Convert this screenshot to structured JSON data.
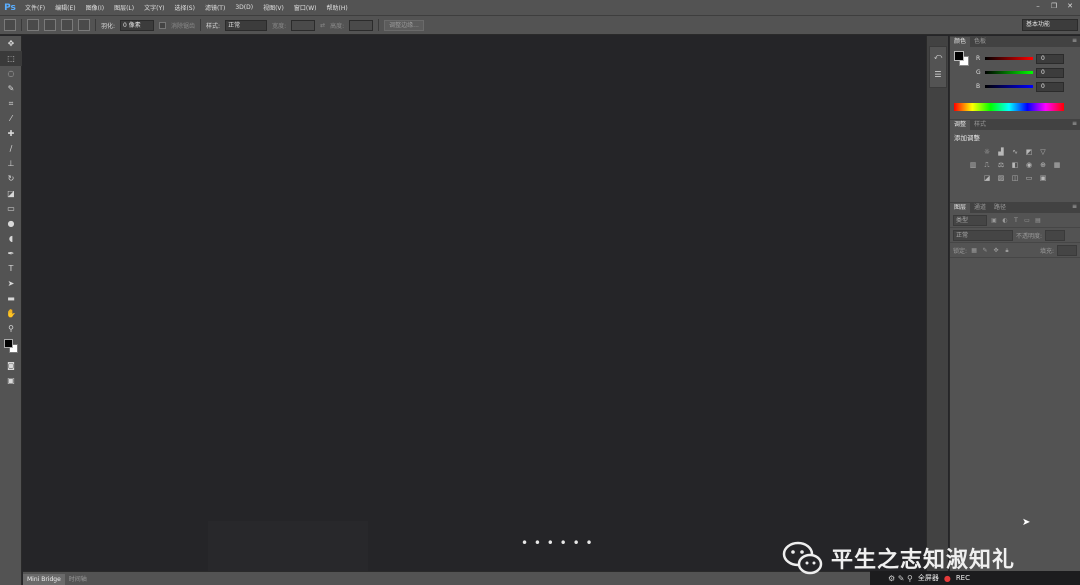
{
  "app": {
    "logo": "Ps"
  },
  "menubar": {
    "items": [
      "文件(F)",
      "编辑(E)",
      "图像(I)",
      "图层(L)",
      "文字(Y)",
      "选择(S)",
      "滤镜(T)",
      "3D(D)",
      "视图(V)",
      "窗口(W)",
      "帮助(H)"
    ]
  },
  "options": {
    "feather_label": "羽化:",
    "feather_value": "0 像素",
    "antialias_label": "消除锯齿",
    "style_label": "样式:",
    "style_value": "正常",
    "width_label": "宽度:",
    "height_label": "高度:",
    "refine_edge_label": "调整边缘...",
    "workspace": "基本功能"
  },
  "status": {
    "tabs": [
      "Mini Bridge",
      "时间轴"
    ]
  },
  "canvas": {
    "loading": "• • • • • •"
  },
  "color_panel": {
    "tabs": [
      "颜色",
      "色板"
    ],
    "sliders": [
      {
        "label": "R",
        "value": "0",
        "track": "linear-gradient(90deg,#000,#f00)"
      },
      {
        "label": "G",
        "value": "0",
        "track": "linear-gradient(90deg,#000,#0f0)"
      },
      {
        "label": "B",
        "value": "0",
        "track": "linear-gradient(90deg,#000,#00f)"
      }
    ]
  },
  "adjustments_panel": {
    "tabs": [
      "调整",
      "样式"
    ],
    "title": "添加调整"
  },
  "layers_panel": {
    "tabs": [
      "图层",
      "通道",
      "路径"
    ],
    "filter_label": "类型",
    "blend_mode": "正常",
    "opacity_label": "不透明度:",
    "lock_label": "锁定:",
    "fill_label": "填充:"
  },
  "watermark": {
    "text": "平生之志知淑知礼"
  },
  "taskbar": {
    "text": "全屏器",
    "rec": "REC"
  },
  "colors": {
    "chrome": "#535353",
    "canvas": "#252528",
    "accent": "#5aaeff"
  }
}
